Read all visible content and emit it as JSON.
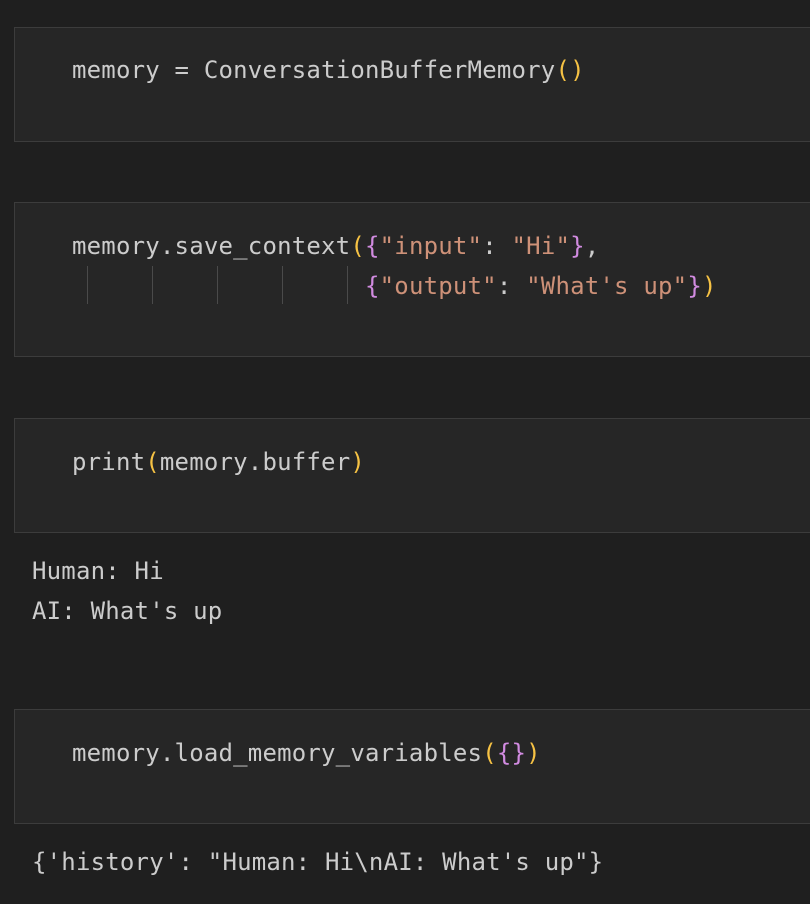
{
  "cells": [
    {
      "lines": [
        [
          {
            "t": "memory",
            "k": "ident"
          },
          {
            "t": " = ",
            "k": "op"
          },
          {
            "t": "ConversationBufferMemory",
            "k": "ident"
          },
          {
            "t": "()",
            "k": "paren"
          }
        ]
      ]
    },
    {
      "lines": [
        [
          {
            "t": "memory.save_context",
            "k": "ident"
          },
          {
            "t": "(",
            "k": "paren"
          },
          {
            "t": "{",
            "k": "brace"
          },
          {
            "t": "\"input\"",
            "k": "str"
          },
          {
            "t": ": ",
            "k": "op"
          },
          {
            "t": "\"Hi\"",
            "k": "str"
          },
          {
            "t": "}",
            "k": "brace"
          },
          {
            "t": ",",
            "k": "op"
          }
        ],
        [
          {
            "t": "                    ",
            "k": "op"
          },
          {
            "t": "{",
            "k": "brace"
          },
          {
            "t": "\"output\"",
            "k": "str"
          },
          {
            "t": ": ",
            "k": "op"
          },
          {
            "t": "\"What's up\"",
            "k": "str"
          },
          {
            "t": "}",
            "k": "brace"
          },
          {
            "t": ")",
            "k": "paren"
          }
        ]
      ]
    },
    {
      "lines": [
        [
          {
            "t": "print",
            "k": "ident"
          },
          {
            "t": "(",
            "k": "paren"
          },
          {
            "t": "memory.buffer",
            "k": "ident"
          },
          {
            "t": ")",
            "k": "paren"
          }
        ]
      ],
      "output": [
        "Human: Hi",
        "AI: What's up"
      ]
    },
    {
      "lines": [
        [
          {
            "t": "memory.load_memory_variables",
            "k": "ident"
          },
          {
            "t": "(",
            "k": "paren"
          },
          {
            "t": "{}",
            "k": "brace"
          },
          {
            "t": ")",
            "k": "paren"
          }
        ]
      ],
      "output": [
        "{'history': \"Human: Hi\\nAI: What's up\"}"
      ]
    }
  ]
}
